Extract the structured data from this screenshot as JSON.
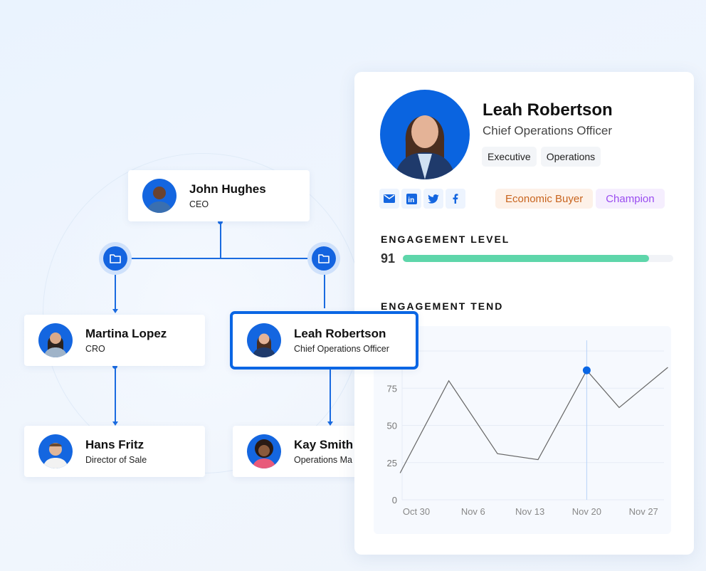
{
  "org_chart": {
    "nodes": [
      {
        "name": "John Hughes",
        "role": "CEO"
      },
      {
        "name": "Martina Lopez",
        "role": "CRO"
      },
      {
        "name": "Leah Robertson",
        "role": "Chief Operations Officer"
      },
      {
        "name": "Hans Fritz",
        "role": "Director of Sale"
      },
      {
        "name": "Kay Smith",
        "role": "Operations Ma"
      }
    ],
    "selected": "Leah Robertson",
    "accent": "#0a66e4"
  },
  "profile": {
    "name": "Leah Robertson",
    "title": "Chief Operations Officer",
    "tags": [
      "Executive",
      "Operations"
    ],
    "socials": [
      "mail-icon",
      "linkedin-icon",
      "twitter-icon",
      "facebook-icon"
    ],
    "roles": [
      {
        "label": "Economic Buyer",
        "color": "#c8641e",
        "bg": "#fdf1e8"
      },
      {
        "label": "Champion",
        "color": "#9a4cf0",
        "bg": "#f5eefe"
      }
    ],
    "engagement_level_label": "ENGAGEMENT LEVEL",
    "engagement_level": 91,
    "engagement_trend_label": "ENGAGEMENT TEND"
  },
  "chart_data": {
    "type": "line",
    "x_tick_labels": [
      "Oct 30",
      "Nov 6",
      "Nov 13",
      "Nov 20",
      "Nov 27"
    ],
    "y_tick_labels": [
      "0",
      "25",
      "50",
      "75"
    ],
    "ylim": [
      0,
      100
    ],
    "grid": true,
    "points": [
      {
        "x": "Oct 28",
        "y": 18
      },
      {
        "x": "Nov 3",
        "y": 80
      },
      {
        "x": "Nov 9",
        "y": 31
      },
      {
        "x": "Nov 14",
        "y": 27
      },
      {
        "x": "Nov 20",
        "y": 87
      },
      {
        "x": "Nov 24",
        "y": 62
      },
      {
        "x": "Nov 30",
        "y": 89
      }
    ],
    "highlighted": "Nov 20",
    "line_color": "#666666",
    "highlight_color": "#0a66e4"
  }
}
